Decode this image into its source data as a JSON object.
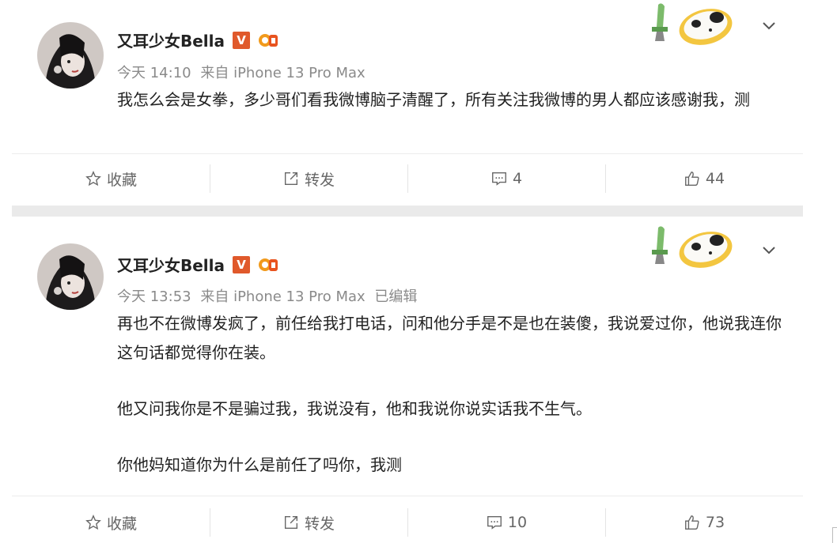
{
  "posts": [
    {
      "username": "又耳少女Bella",
      "vip_badge": "V",
      "time": "今天 14:10",
      "source": "来自 iPhone 13 Pro Max",
      "edited": "",
      "paragraphs": [
        "我怎么会是女拳，多少哥们看我微博脑子清醒了，所有关注我微博的男人都应该感谢我，测"
      ],
      "actions": {
        "favorite": "收藏",
        "repost": "转发",
        "comments": "4",
        "likes": "44"
      }
    },
    {
      "username": "又耳少女Bella",
      "vip_badge": "V",
      "time": "今天 13:53",
      "source": "来自 iPhone 13 Pro Max",
      "edited": "已编辑",
      "paragraphs": [
        "再也不在微博发疯了，前任给我打电话，问和他分手是不是也在装傻，我说爱过你，他说我连你这句话都觉得你在装。",
        "他又问我你是不是骗过我，我说没有，他和我说你说实话我不生气。",
        "你他妈知道你为什么是前任了吗你，我测"
      ],
      "actions": {
        "favorite": "收藏",
        "repost": "转发",
        "comments": "10",
        "likes": "73"
      }
    }
  ],
  "colors": {
    "vip": "#e0592b",
    "meta": "#8a8a8a",
    "text": "#222222",
    "action": "#666666"
  }
}
